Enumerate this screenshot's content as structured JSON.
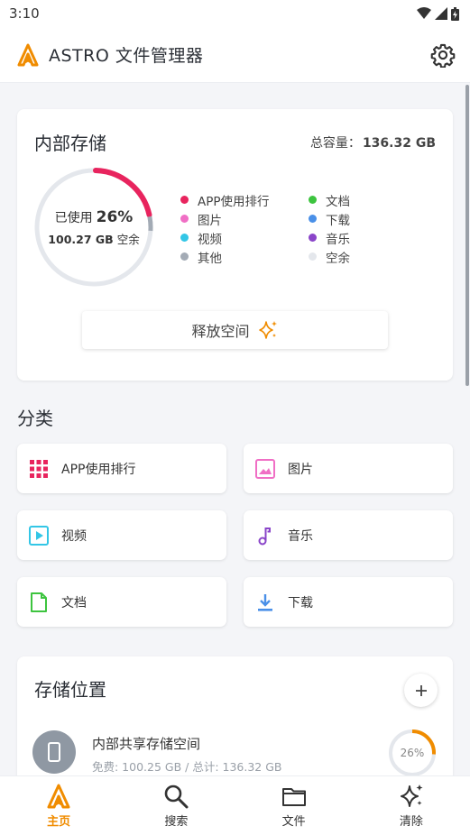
{
  "status_bar": {
    "time": "3:10"
  },
  "app_bar": {
    "title": "ASTRO 文件管理器"
  },
  "storage": {
    "title": "内部存储",
    "capacity_label": "总容量：",
    "capacity_value": "136.32 GB",
    "used_label": "已使用",
    "used_percent": "26%",
    "used_fraction": 0.26,
    "free_value": "100.27 GB",
    "free_label": "空余",
    "legend": [
      {
        "label": "APP使用排行",
        "color": "#e8245e"
      },
      {
        "label": "文档",
        "color": "#3dc43f"
      },
      {
        "label": "图片",
        "color": "#f06fc5"
      },
      {
        "label": "下载",
        "color": "#4a90e8"
      },
      {
        "label": "视频",
        "color": "#33c6e6"
      },
      {
        "label": "音乐",
        "color": "#8a45c9"
      },
      {
        "label": "其他",
        "color": "#a3abb5"
      },
      {
        "label": "空余",
        "color": "#e4e7ec"
      }
    ],
    "free_space_button": "释放空间"
  },
  "categories": {
    "title": "分类",
    "items": [
      {
        "label": "APP使用排行",
        "icon": "grid-icon",
        "color": "#e8245e"
      },
      {
        "label": "图片",
        "icon": "image-icon",
        "color": "#f06fc5"
      },
      {
        "label": "视频",
        "icon": "video-icon",
        "color": "#33c6e6"
      },
      {
        "label": "音乐",
        "icon": "music-icon",
        "color": "#8a45c9"
      },
      {
        "label": "文档",
        "icon": "document-icon",
        "color": "#3dc43f"
      },
      {
        "label": "下载",
        "icon": "download-icon",
        "color": "#4a90e8"
      }
    ]
  },
  "locations": {
    "title": "存储位置",
    "items": [
      {
        "name": "内部共享存储空间",
        "detail": "免费: 100.25 GB / 总计: 136.32 GB",
        "percent": "26%",
        "fraction": 0.26
      }
    ]
  },
  "bottom_nav": [
    {
      "label": "主页",
      "icon": "home-logo-icon",
      "active": true
    },
    {
      "label": "搜索",
      "icon": "search-icon",
      "active": false
    },
    {
      "label": "文件",
      "icon": "folder-icon",
      "active": false
    },
    {
      "label": "清除",
      "icon": "sparkle-icon",
      "active": false
    }
  ],
  "colors": {
    "accent": "#f08c00",
    "used_arc": "#e8245e",
    "ring_track": "#e4e7ec"
  }
}
